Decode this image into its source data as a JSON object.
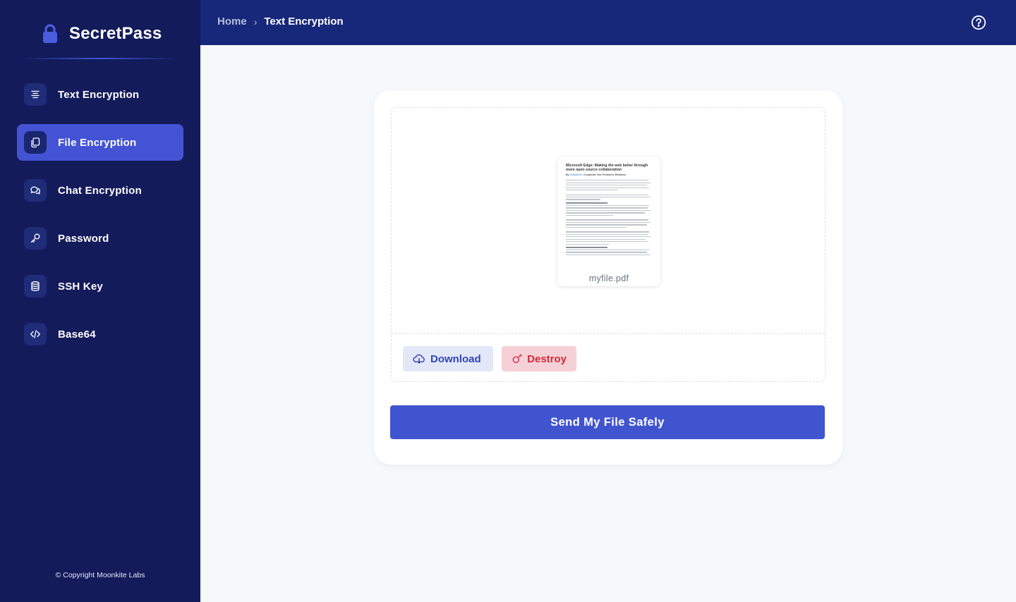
{
  "app": {
    "name": "SecretPass"
  },
  "sidebar": {
    "items": [
      {
        "label": "Text Encryption",
        "icon": "text-align-icon",
        "active": false
      },
      {
        "label": "File Encryption",
        "icon": "files-icon",
        "active": true
      },
      {
        "label": "Chat Encryption",
        "icon": "chat-bubbles-icon",
        "active": false
      },
      {
        "label": "Password",
        "icon": "key-icon",
        "active": false
      },
      {
        "label": "SSH Key",
        "icon": "database-icon",
        "active": false
      },
      {
        "label": "Base64",
        "icon": "code-icon",
        "active": false
      }
    ],
    "copyright": "© Copyright Moonkite Labs"
  },
  "header": {
    "breadcrumb": {
      "home": "Home",
      "separator": "›",
      "current": "Text Encryption"
    },
    "help_icon": "question-circle-icon"
  },
  "file": {
    "name": "myfile.pdf",
    "preview": {
      "title": "Microsoft Edge: Making the web better through more open source collaboration",
      "byline_prefix": "By",
      "byline_author": "JoeBelfiore",
      "byline_suffix": "/ Corporate Vice President, Windows"
    }
  },
  "actions": {
    "download_label": "Download",
    "destroy_label": "Destroy",
    "send_label": "Send My File Safely"
  },
  "colors": {
    "sidebar_bg": "#131b5b",
    "header_bg": "#17287a",
    "accent": "#4353d4",
    "destroy": "#d32a3b"
  }
}
